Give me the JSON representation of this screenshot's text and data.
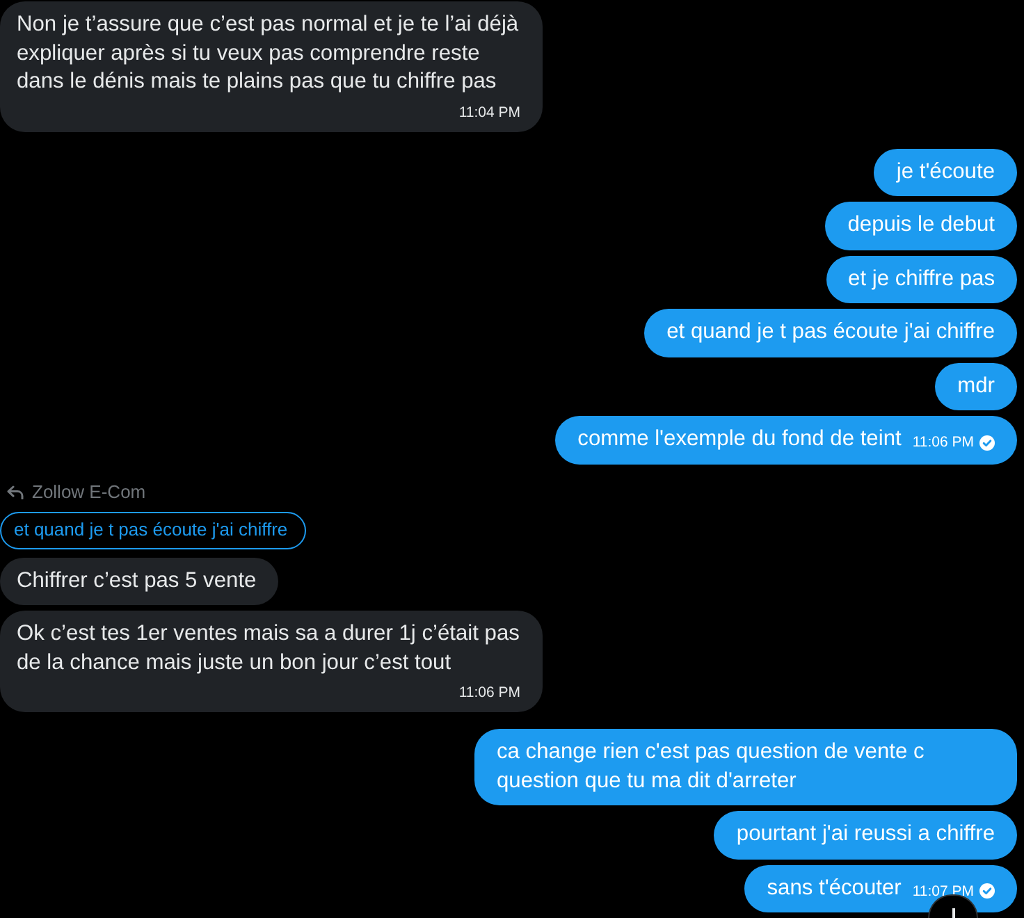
{
  "messages": [
    {
      "kind": "received",
      "text": "Non je t’assure que c’est pas normal et je te l’ai déjà expliquer après si tu veux pas comprendre reste dans le dénis mais te plains pas que tu chiffre pas",
      "time": "11:04 PM"
    },
    {
      "kind": "sent",
      "text": "je t'écoute"
    },
    {
      "kind": "sent",
      "text": "depuis le debut"
    },
    {
      "kind": "sent",
      "text": "et je chiffre pas"
    },
    {
      "kind": "sent",
      "text": "et quand je t pas écoute j'ai chiffre"
    },
    {
      "kind": "sent",
      "text": "mdr"
    },
    {
      "kind": "sent",
      "text": "comme l'exemple du fond de teint",
      "time": "11:06 PM",
      "seen": true
    },
    {
      "kind": "received",
      "reply_to": {
        "author": "Zollow E-Com",
        "text": "et quand je t pas écoute j'ai chiffre"
      },
      "text": "Chiffrer c’est pas 5 vente"
    },
    {
      "kind": "received",
      "text": "Ok c’est tes 1er ventes mais sa a durer 1j c’était pas de la chance mais juste un bon jour c’est tout",
      "time": "11:06 PM"
    },
    {
      "kind": "sent",
      "text": "ca change rien c'est pas question de vente c question que tu ma dit d'arreter"
    },
    {
      "kind": "sent",
      "text": "pourtant j'ai reussi a chiffre"
    },
    {
      "kind": "sent",
      "text": "sans t'écouter",
      "time": "11:07 PM",
      "seen": true
    }
  ]
}
